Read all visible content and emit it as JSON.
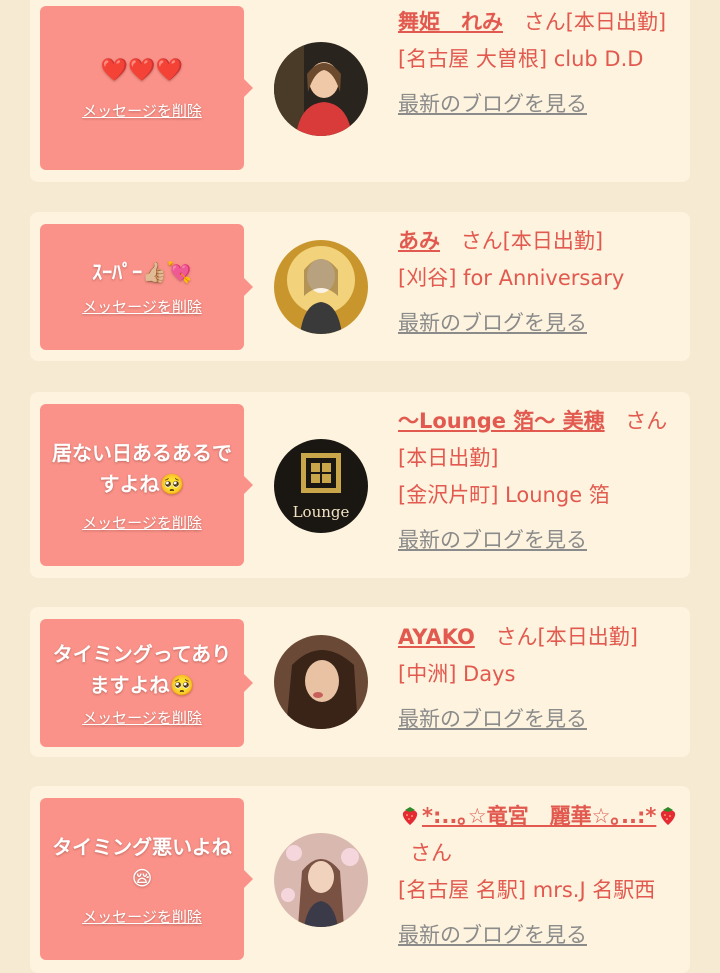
{
  "items": [
    {
      "message": "❤️❤️❤️",
      "delete_label": "メッセージを削除",
      "name": "舞姫　れみ",
      "suffix": "さん[本日出勤]",
      "shop": "[名古屋 大曽根] club D.D",
      "blog_link": "最新のブログを見る"
    },
    {
      "message": "ｽｰﾊﾟｰ👍🏼💘",
      "delete_label": "メッセージを削除",
      "name": "あみ",
      "suffix": "さん[本日出勤]",
      "shop": "[刈谷] for Anniversary",
      "blog_link": "最新のブログを見る"
    },
    {
      "message": "居ない日あるあるですよね🥺",
      "delete_label": "メッセージを削除",
      "name": "〜Lounge 箔〜 美穂",
      "suffix": "さん[本日出勤]",
      "shop": "[金沢片町] Lounge 箔",
      "blog_link": "最新のブログを見る",
      "avatar_text": "Lounge"
    },
    {
      "message": "タイミングってありますよね🥺",
      "delete_label": "メッセージを削除",
      "name": "AYAKO",
      "suffix": "さん[本日出勤]",
      "shop": "[中洲] Days",
      "blog_link": "最新のブログを見る"
    },
    {
      "message": "タイミング悪いよね😪",
      "delete_label": "メッセージを削除",
      "name": "*:..｡☆竜宮　麗華☆｡..:*",
      "suffix": "さん",
      "shop": "[名古屋 名駅] mrs.J 名駅西",
      "blog_link": "最新のブログを見る"
    }
  ]
}
